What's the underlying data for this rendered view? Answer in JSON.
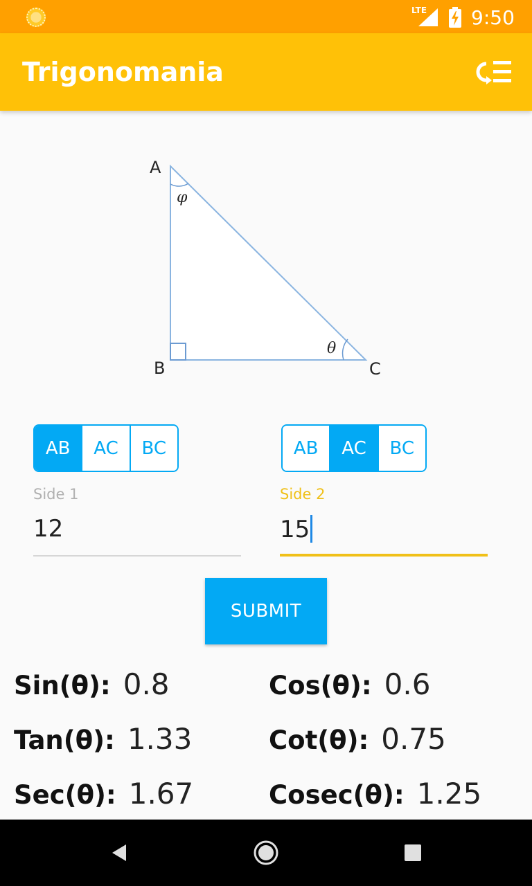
{
  "status_bar": {
    "network": "LTE",
    "time": "9:50"
  },
  "app_bar": {
    "title": "Trigonomania",
    "menu_icon": "settings-list-icon"
  },
  "diagram": {
    "vertices": [
      "A",
      "B",
      "C"
    ],
    "angle_top": "φ",
    "angle_right": "θ",
    "right_angle_at": "B"
  },
  "selectors": {
    "side1": {
      "options": [
        "AB",
        "AC",
        "BC"
      ],
      "selected": "AB"
    },
    "side2": {
      "options": [
        "AB",
        "AC",
        "BC"
      ],
      "selected": "AC"
    }
  },
  "inputs": {
    "side1": {
      "label": "Side 1",
      "value": "12"
    },
    "side2": {
      "label": "Side 2",
      "value": "15"
    }
  },
  "submit_label": "SUBMIT",
  "results": {
    "sin": {
      "label": "Sin(θ):",
      "value": "0.8"
    },
    "cos": {
      "label": "Cos(θ):",
      "value": "0.6"
    },
    "tan": {
      "label": "Tan(θ):",
      "value": "1.33"
    },
    "cot": {
      "label": "Cot(θ):",
      "value": "0.75"
    },
    "sec": {
      "label": "Sec(θ):",
      "value": "1.67"
    },
    "cosec": {
      "label": "Cosec(θ):",
      "value": "1.25"
    }
  },
  "colors": {
    "status_bar": "#ffa000",
    "app_bar": "#ffc107",
    "accent_blue": "#03a9f4",
    "focus_yellow": "#f0c018"
  }
}
